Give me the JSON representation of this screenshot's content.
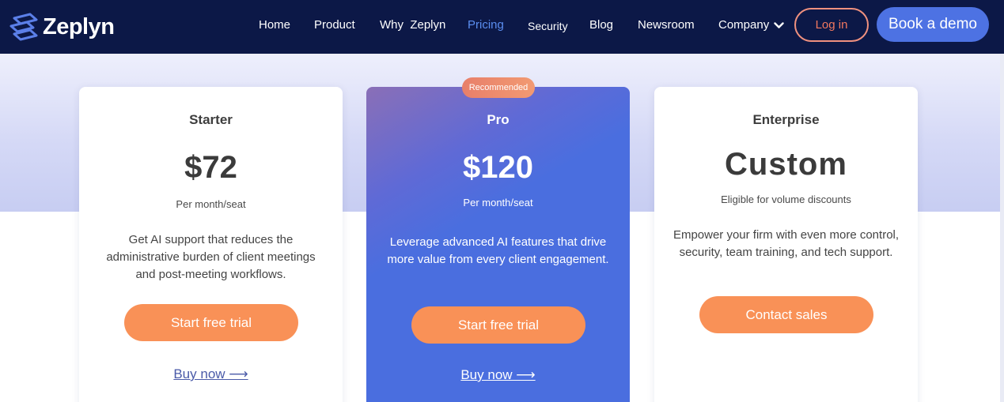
{
  "brand": {
    "name": "Zeplyn",
    "logo_icon": "zeplyn-logo-icon"
  },
  "colors": {
    "nav_bg": "#0c1847",
    "accent_blue": "#4d72e3",
    "active_link": "#5b8ef0",
    "cta_orange": "#f99157",
    "login_border": "#f0917f"
  },
  "nav": {
    "links": [
      "Home",
      "Product",
      "Why  Zeplyn",
      "Pricing",
      "Security",
      "Blog",
      "Newsroom",
      "Company"
    ],
    "active": "Pricing",
    "login_label": "Log in",
    "demo_label": "Book a demo"
  },
  "plans": [
    {
      "name": "Starter",
      "price": "$72",
      "price_note": "Per month/seat",
      "description": "Get AI support that reduces the administrative burden of client meetings and post-meeting workflows.",
      "cta": "Start free trial",
      "link": "Buy now ⟶"
    },
    {
      "name": "Pro",
      "badge": "Recommended",
      "price": "$120",
      "price_note": "Per month/seat",
      "description": "Leverage advanced AI features that drive more value from every client engagement.",
      "cta": "Start free trial",
      "link": "Buy now ⟶"
    },
    {
      "name": "Enterprise",
      "price": "Custom",
      "price_note": "Eligible for volume discounts",
      "description": "Empower your firm with even more control, security, team training, and tech support.",
      "cta": "Contact sales"
    }
  ]
}
